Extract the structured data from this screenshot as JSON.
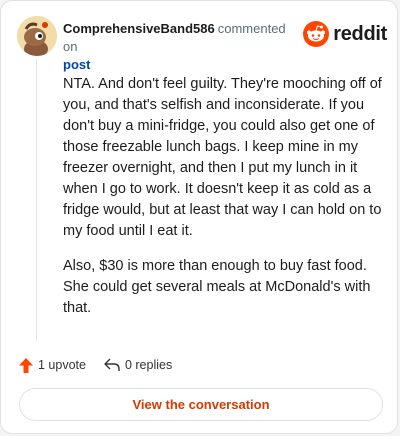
{
  "header": {
    "username": "ComprehensiveBand586",
    "action_text": "commented on",
    "post_link": "post",
    "logo_text": "reddit"
  },
  "comment": {
    "paragraphs": [
      "NTA. And don't feel guilty. They're mooching off of you, and that's selfish and inconsiderate. If you don't buy a mini-fridge, you could also get one of those freezable lunch bags. I keep mine in my freezer overnight, and then I put my lunch in it when I go to work. It doesn't keep it as cold as a fridge would, but at least that way I can hold on to my food until I eat it.",
      "Also, $30 is more than enough to buy fast food. She could get several meals at McDonald's with that."
    ]
  },
  "actions": {
    "upvote_label": "1 upvote",
    "replies_label": "0 replies"
  },
  "cta": {
    "label": "View the conversation"
  },
  "icons": {
    "avatar": "snoo-avatar-icon",
    "logo": "reddit-alien-icon",
    "upvote": "upvote-arrow-icon",
    "reply": "reply-arrow-icon"
  },
  "colors": {
    "reddit_orange": "#ff4500",
    "link_blue": "#0045ac",
    "cta_text": "#d93a00",
    "meta_gray": "#576f76"
  }
}
